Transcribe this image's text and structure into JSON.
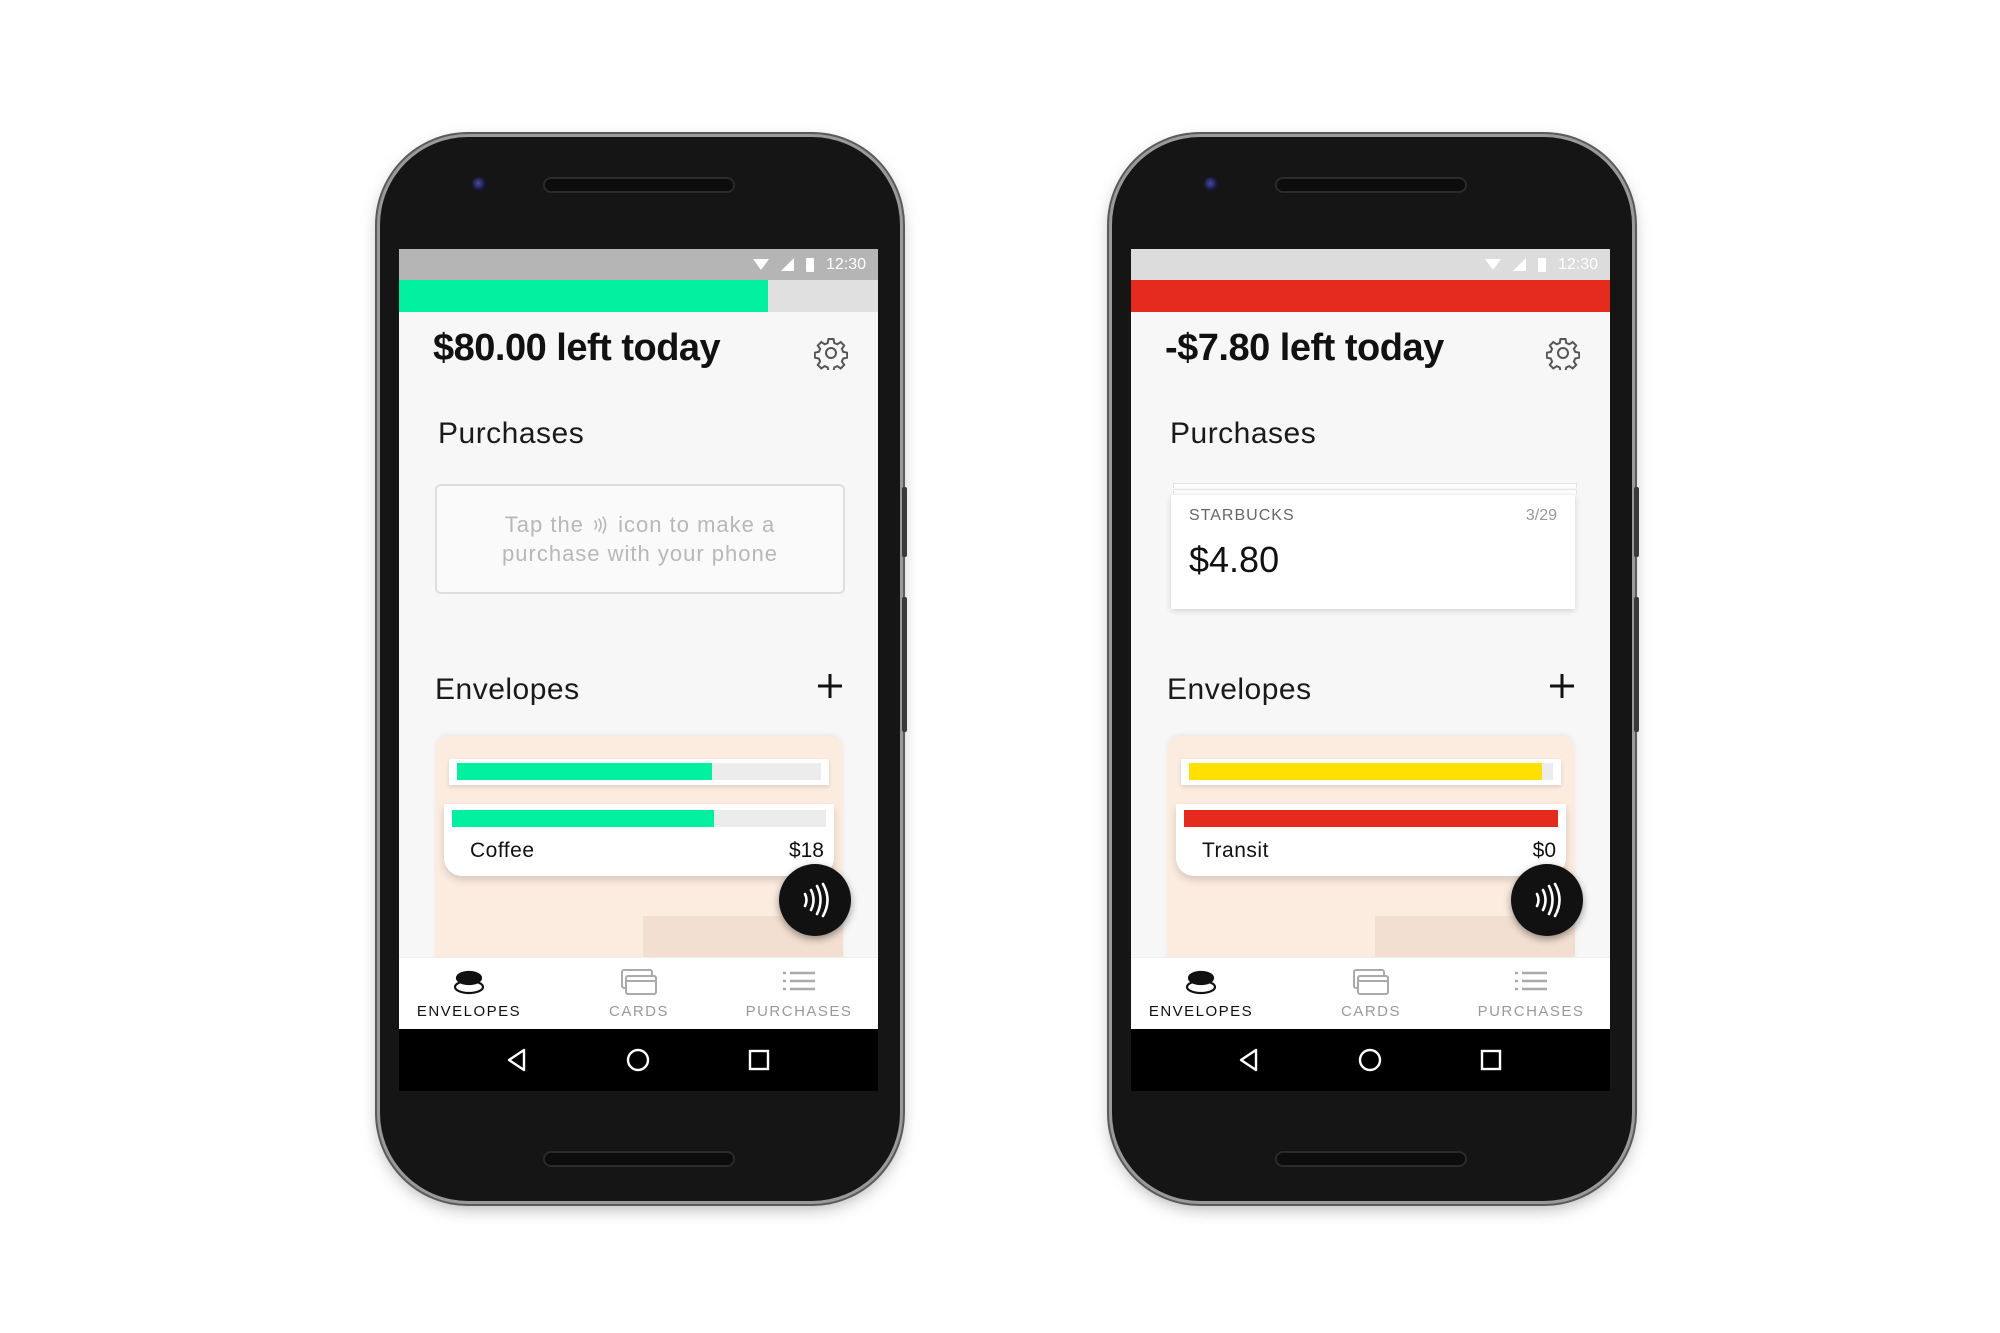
{
  "phones": [
    {
      "status": {
        "time": "12:30"
      },
      "budget": {
        "fraction_remaining": 0.77,
        "color": "#00f0a0"
      },
      "headline": "$80.00 left today",
      "purchases": {
        "title": "Purchases",
        "empty_text_before": "Tap the",
        "empty_text_after": "icon to make a purchase with your phone"
      },
      "envelopes": {
        "title": "Envelopes",
        "back_card": {
          "fraction": 0.7,
          "color": "#00f0a0"
        },
        "front_card": {
          "name": "Coffee",
          "amount": "$18",
          "fraction": 0.7,
          "color": "#00f0a0"
        }
      },
      "nav": {
        "envelopes": "ENVELOPES",
        "cards": "CARDS",
        "purchases": "PURCHASES"
      }
    },
    {
      "status": {
        "time": "12:30"
      },
      "budget": {
        "fraction_remaining": 1.0,
        "color": "#e52a1e"
      },
      "headline": "-$7.80 left today",
      "purchases": {
        "title": "Purchases",
        "card": {
          "merchant": "STARBUCKS",
          "date": "3/29",
          "amount": "$4.80"
        }
      },
      "envelopes": {
        "title": "Envelopes",
        "back_card": {
          "fraction": 0.97,
          "color": "#ffe000"
        },
        "front_card": {
          "name": "Transit",
          "amount": "$0",
          "fraction": 1.0,
          "color": "#e52a1e"
        }
      },
      "nav": {
        "envelopes": "ENVELOPES",
        "cards": "CARDS",
        "purchases": "PURCHASES"
      }
    }
  ],
  "icons": {
    "settings": "gear-icon",
    "add": "plus-icon",
    "pay": "contactless-icon",
    "nav": [
      "coins-icon",
      "cards-icon",
      "list-icon"
    ],
    "system": [
      "back-icon",
      "home-icon",
      "recents-icon"
    ]
  }
}
